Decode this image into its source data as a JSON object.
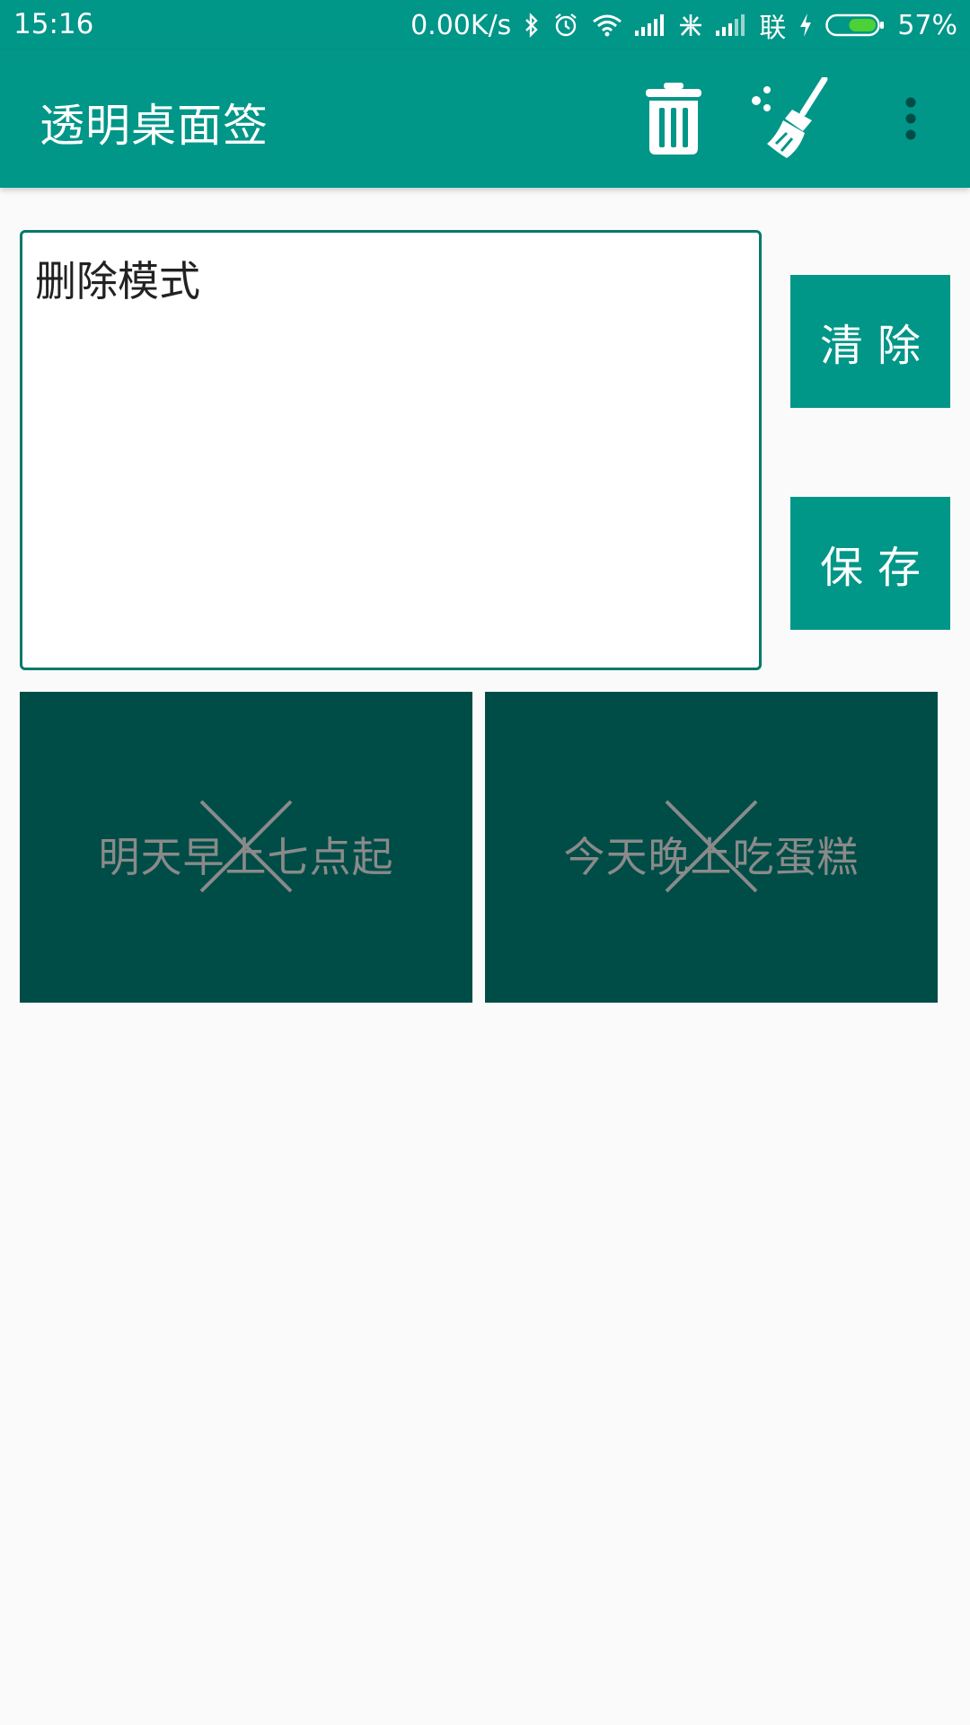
{
  "status_bar": {
    "time": "15:16",
    "network_speed": "0.00K/s",
    "carrier": "联",
    "battery_percent": "57%",
    "battery_level": 0.57,
    "icons": [
      "bluetooth-icon",
      "alarm-icon",
      "wifi-icon",
      "signal-icon",
      "mi-icon",
      "signal-icon",
      "charging-icon",
      "battery-icon"
    ]
  },
  "toolbar": {
    "title": "透明桌面签",
    "actions": [
      "trash-icon",
      "broom-icon",
      "more-vert-icon"
    ]
  },
  "editor": {
    "value": "删除模式"
  },
  "buttons": {
    "clear_label": "清除",
    "save_label": "保存"
  },
  "notes": [
    {
      "text": "明天早上七点起"
    },
    {
      "text": "今天晚上吃蛋糕"
    }
  ],
  "colors": {
    "primary": "#009688",
    "primary_dark": "#00796b",
    "card_bg": "#004d47",
    "card_text": "#8a8a8a",
    "page_bg": "#fafafa",
    "battery_fill": "#4cd137"
  }
}
